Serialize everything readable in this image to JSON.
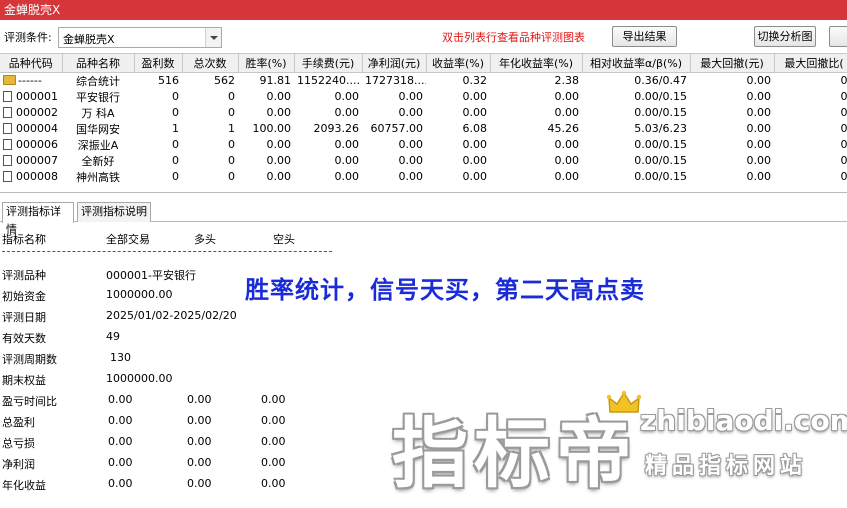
{
  "window": {
    "title": "金蝉脱壳X"
  },
  "toolbar": {
    "condition_label": "评测条件:",
    "condition_value": "金蝉脱壳X",
    "hint": "双击列表行查看品种评测图表",
    "export_label": "导出结果",
    "switch_label": "切换分析图",
    "extra_label": ""
  },
  "grid": {
    "headers": [
      "品种代码",
      "品种名称",
      "盈利数",
      "总次数",
      "胜率(%)",
      "手续费(元)",
      "净利润(元)",
      "收益率(%)",
      "年化收益率(%)",
      "相对收益率α/β(%)",
      "最大回撤(元)",
      "最大回撤比("
    ],
    "rows": [
      [
        "------",
        "综合统计",
        "516",
        "562",
        "91.81",
        "1152240....",
        "1727318....",
        "0.32",
        "2.38",
        "0.36/0.47",
        "0.00",
        "0."
      ],
      [
        "000001",
        "平安银行",
        "0",
        "0",
        "0.00",
        "0.00",
        "0.00",
        "0.00",
        "0.00",
        "0.00/0.15",
        "0.00",
        "0."
      ],
      [
        "000002",
        "万 科A",
        "0",
        "0",
        "0.00",
        "0.00",
        "0.00",
        "0.00",
        "0.00",
        "0.00/0.15",
        "0.00",
        "0."
      ],
      [
        "000004",
        "国华网安",
        "1",
        "1",
        "100.00",
        "2093.26",
        "60757.00",
        "6.08",
        "45.26",
        "5.03/6.23",
        "0.00",
        "0."
      ],
      [
        "000006",
        "深振业A",
        "0",
        "0",
        "0.00",
        "0.00",
        "0.00",
        "0.00",
        "0.00",
        "0.00/0.15",
        "0.00",
        "0."
      ],
      [
        "000007",
        "全新好",
        "0",
        "0",
        "0.00",
        "0.00",
        "0.00",
        "0.00",
        "0.00",
        "0.00/0.15",
        "0.00",
        "0."
      ],
      [
        "000008",
        "神州高铁",
        "0",
        "0",
        "0.00",
        "0.00",
        "0.00",
        "0.00",
        "0.00",
        "0.00/0.15",
        "0.00",
        "0."
      ]
    ]
  },
  "tabs": [
    "评测指标详情",
    "评测指标说明"
  ],
  "detail": {
    "headers": [
      "指标名称",
      "全部交易",
      "多头",
      "空头"
    ],
    "rows": [
      {
        "label": "评测品种",
        "values": [
          "000001-平安银行"
        ]
      },
      {
        "label": "初始资金",
        "values": [
          "1000000.00"
        ]
      },
      {
        "label": "评测日期",
        "values": [
          "2025/01/02-2025/02/20"
        ]
      },
      {
        "label": "有效天数",
        "values": [
          "49"
        ]
      },
      {
        "label": "评测周期数",
        "values": [
          "130"
        ]
      },
      {
        "label": "期末权益",
        "values": [
          "1000000.00"
        ]
      },
      {
        "label": "盈亏时间比",
        "values": [
          "0.00",
          "0.00",
          "0.00"
        ]
      },
      {
        "label": "总盈利",
        "values": [
          "0.00",
          "0.00",
          "0.00"
        ]
      },
      {
        "label": "总亏损",
        "values": [
          "0.00",
          "0.00",
          "0.00"
        ]
      },
      {
        "label": "净利润",
        "values": [
          "0.00",
          "0.00",
          "0.00"
        ]
      },
      {
        "label": "年化收益",
        "values": [
          "0.00",
          "0.00",
          "0.00"
        ]
      }
    ]
  },
  "annotation": "胜率统计，信号天买，第二天高点卖",
  "watermark": {
    "brand": "指标帝",
    "url": "zhibiaodi.com",
    "slogan": "精品指标网站"
  },
  "colors": {
    "titlebar": "#d6363a",
    "hint": "#e01818",
    "annotation": "#1a2cd8"
  }
}
